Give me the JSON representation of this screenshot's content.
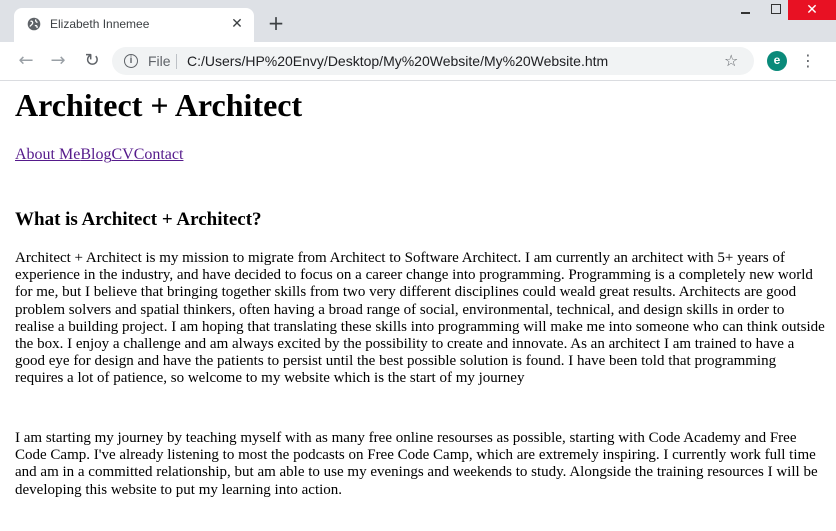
{
  "browser": {
    "tab_title": "Elizabeth Innemee",
    "tab_close_glyph": "✕",
    "new_tab_glyph": "+",
    "url_scheme": "File",
    "url": "C:/Users/HP%20Envy/Desktop/My%20Website/My%20Website.htm",
    "profile_initial": "e",
    "profile_color": "#0a8a7a",
    "close_button_color": "#e81123",
    "icons": {
      "favicon": "globe-icon",
      "back": "arrow-left-icon",
      "forward": "arrow-right-icon",
      "reload": "reload-icon",
      "info": "info-icon",
      "bookmark": "star-icon",
      "menu": "kebab-menu-icon"
    }
  },
  "page": {
    "title": "Architect + Architect",
    "nav": [
      "About Me",
      "Blog",
      "CV",
      "Contact"
    ],
    "link_color": "#551a8b",
    "section_heading": "What is Architect + Architect?",
    "paragraphs": [
      "Architect + Architect is my mission to migrate from Architect to Software Architect. I am currently an architect with 5+ years of experience in the industry, and have decided to focus on a career change into programming. Programming is a completely new world for me, but I believe that bringing together skills from two very different disciplines could weald great results. Architects are good problem solvers and spatial thinkers, often having a broad range of social, environmental, technical, and design skills in order to realise a building project. I am hoping that translating these skills into programming will make me into someone who can think outside the box. I enjoy a challenge and am always excited by the possibility to create and innovate. As an architect I am trained to have a good eye for design and have the patients to persist until the best possible solution is found. I have been told that programming requires a lot of patience, so welcome to my website which is the start of my journey",
      "I am starting my journey by teaching myself with as many free online resourses as possible, starting with Code Academy and Free Code Camp. I've already listening to most the podcasts on Free Code Camp, which are extremely inspiring. I currently work full time and am in a committed relationship, but am able to use my evenings and weekends to study. Alongside the training resources I will be developing this website to put my learning into action."
    ]
  }
}
